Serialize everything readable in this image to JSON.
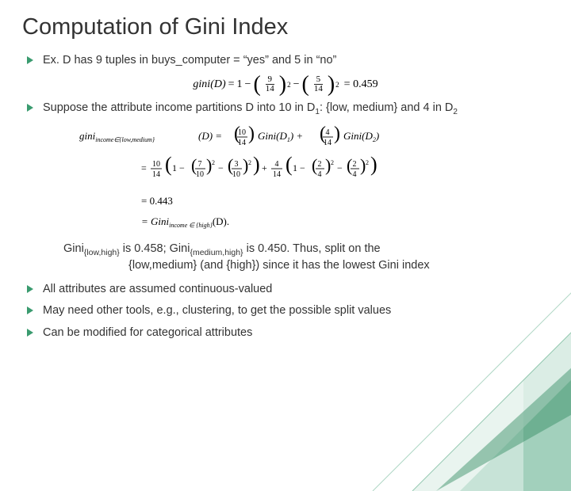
{
  "title": "Computation of Gini Index",
  "bullets": {
    "b1_pre": "Ex.  D has 9 tuples in buys_computer = ",
    "b1_yes": "“yes”",
    "b1_mid": " and 5 in ",
    "b1_no": "“no”",
    "b2_pre": "Suppose the attribute income partitions D into 10 in D",
    "b2_sub1": "1",
    "b2_mid": ": {low, medium} and 4 in D",
    "b2_sub2": "2",
    "b3": "All attributes are assumed continuous-valued",
    "b4": "May need other tools, e.g., clustering, to get the possible split values",
    "b5": "Can be modified for categorical attributes"
  },
  "eq1": {
    "lhs": "gini(D)",
    "eq": "=",
    "one": "1",
    "minus": "−",
    "n1": "9",
    "d1": "14",
    "n2": "5",
    "d2": "14",
    "exp": "2",
    "rhs": "= 0.459"
  },
  "eq2": {
    "line1_lhs": "gini",
    "line1_sub": "income∈{low,medium}",
    "line1_d": "(D) =",
    "line1_f1n": "10",
    "line1_f1d": "14",
    "line1_g1": "Gini(D",
    "line1_g1s": "1",
    "line1_plus": ") + ",
    "line1_f2n": "4",
    "line1_f2d": "14",
    "line1_g2": "Gini(D",
    "line1_g2s": "2",
    "line1_end": ")",
    "line2_f1n": "10",
    "line2_f1d": "14",
    "line2_in1a_n": "7",
    "line2_in1a_d": "10",
    "line2_in1b_n": "3",
    "line2_in1b_d": "10",
    "line2_f2n": "4",
    "line2_f2d": "14",
    "line2_in2a_n": "2",
    "line2_in2a_d": "4",
    "line2_in2b_n": "2",
    "line2_in2b_d": "4",
    "line3": "= 0.443",
    "line4_pre": "= Gini",
    "line4_sub": "income ∈ {high}",
    "line4_end": "(D)."
  },
  "gini_line": {
    "p1": "Gini",
    "s1": "{low,high}",
    "p2": " is 0.458; Gini",
    "s2": "{medium,high}",
    "p3": " is 0.450.  Thus, split on the",
    "p4": "{low,medium} (and {high}) since it has the lowest Gini index"
  }
}
